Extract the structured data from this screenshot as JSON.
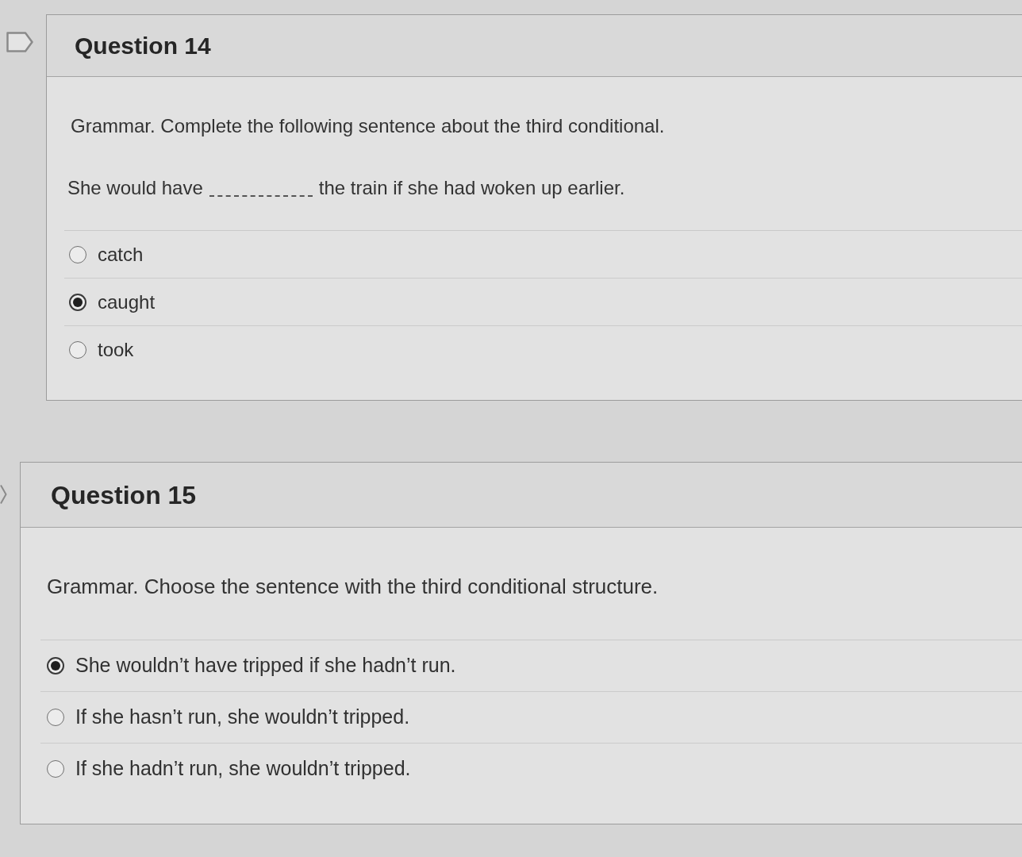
{
  "questions": [
    {
      "title": "Question 14",
      "prompt": "Grammar. Complete the following sentence about the third conditional.",
      "sentence": {
        "before": "She would have",
        "after": "the train if she had woken up earlier."
      },
      "options": [
        {
          "label": "catch",
          "selected": false
        },
        {
          "label": "caught",
          "selected": true
        },
        {
          "label": "took",
          "selected": false
        }
      ]
    },
    {
      "title": "Question 15",
      "prompt": "Grammar. Choose the sentence with the third conditional structure.",
      "options": [
        {
          "label": "She wouldn’t have tripped if she hadn’t run.",
          "selected": true
        },
        {
          "label": "If she hasn’t run, she wouldn’t tripped.",
          "selected": false
        },
        {
          "label": "If she hadn’t run, she wouldn’t tripped.",
          "selected": false
        }
      ]
    }
  ]
}
